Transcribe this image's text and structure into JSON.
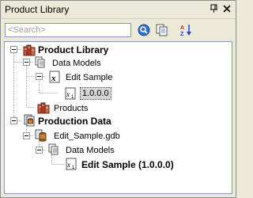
{
  "window": {
    "title": "Product Library"
  },
  "toolbar": {
    "search_placeholder": "<Search>",
    "search_value": ""
  },
  "tree": {
    "product_library": "Product Library",
    "data_models": "Data Models",
    "edit_sample": "Edit Sample",
    "version": "1.0.0.0",
    "products": "Products",
    "production_data": "Production Data",
    "gdb": "Edit_Sample.gdb",
    "data_models_2": "Data Models",
    "edit_sample_version": "Edit Sample (1.0.0.0)"
  },
  "icons": {
    "title_pin": "pin-icon",
    "title_close": "close-icon",
    "search": "search-icon",
    "copy": "copy-icon",
    "sort": "sort-az-icon"
  }
}
